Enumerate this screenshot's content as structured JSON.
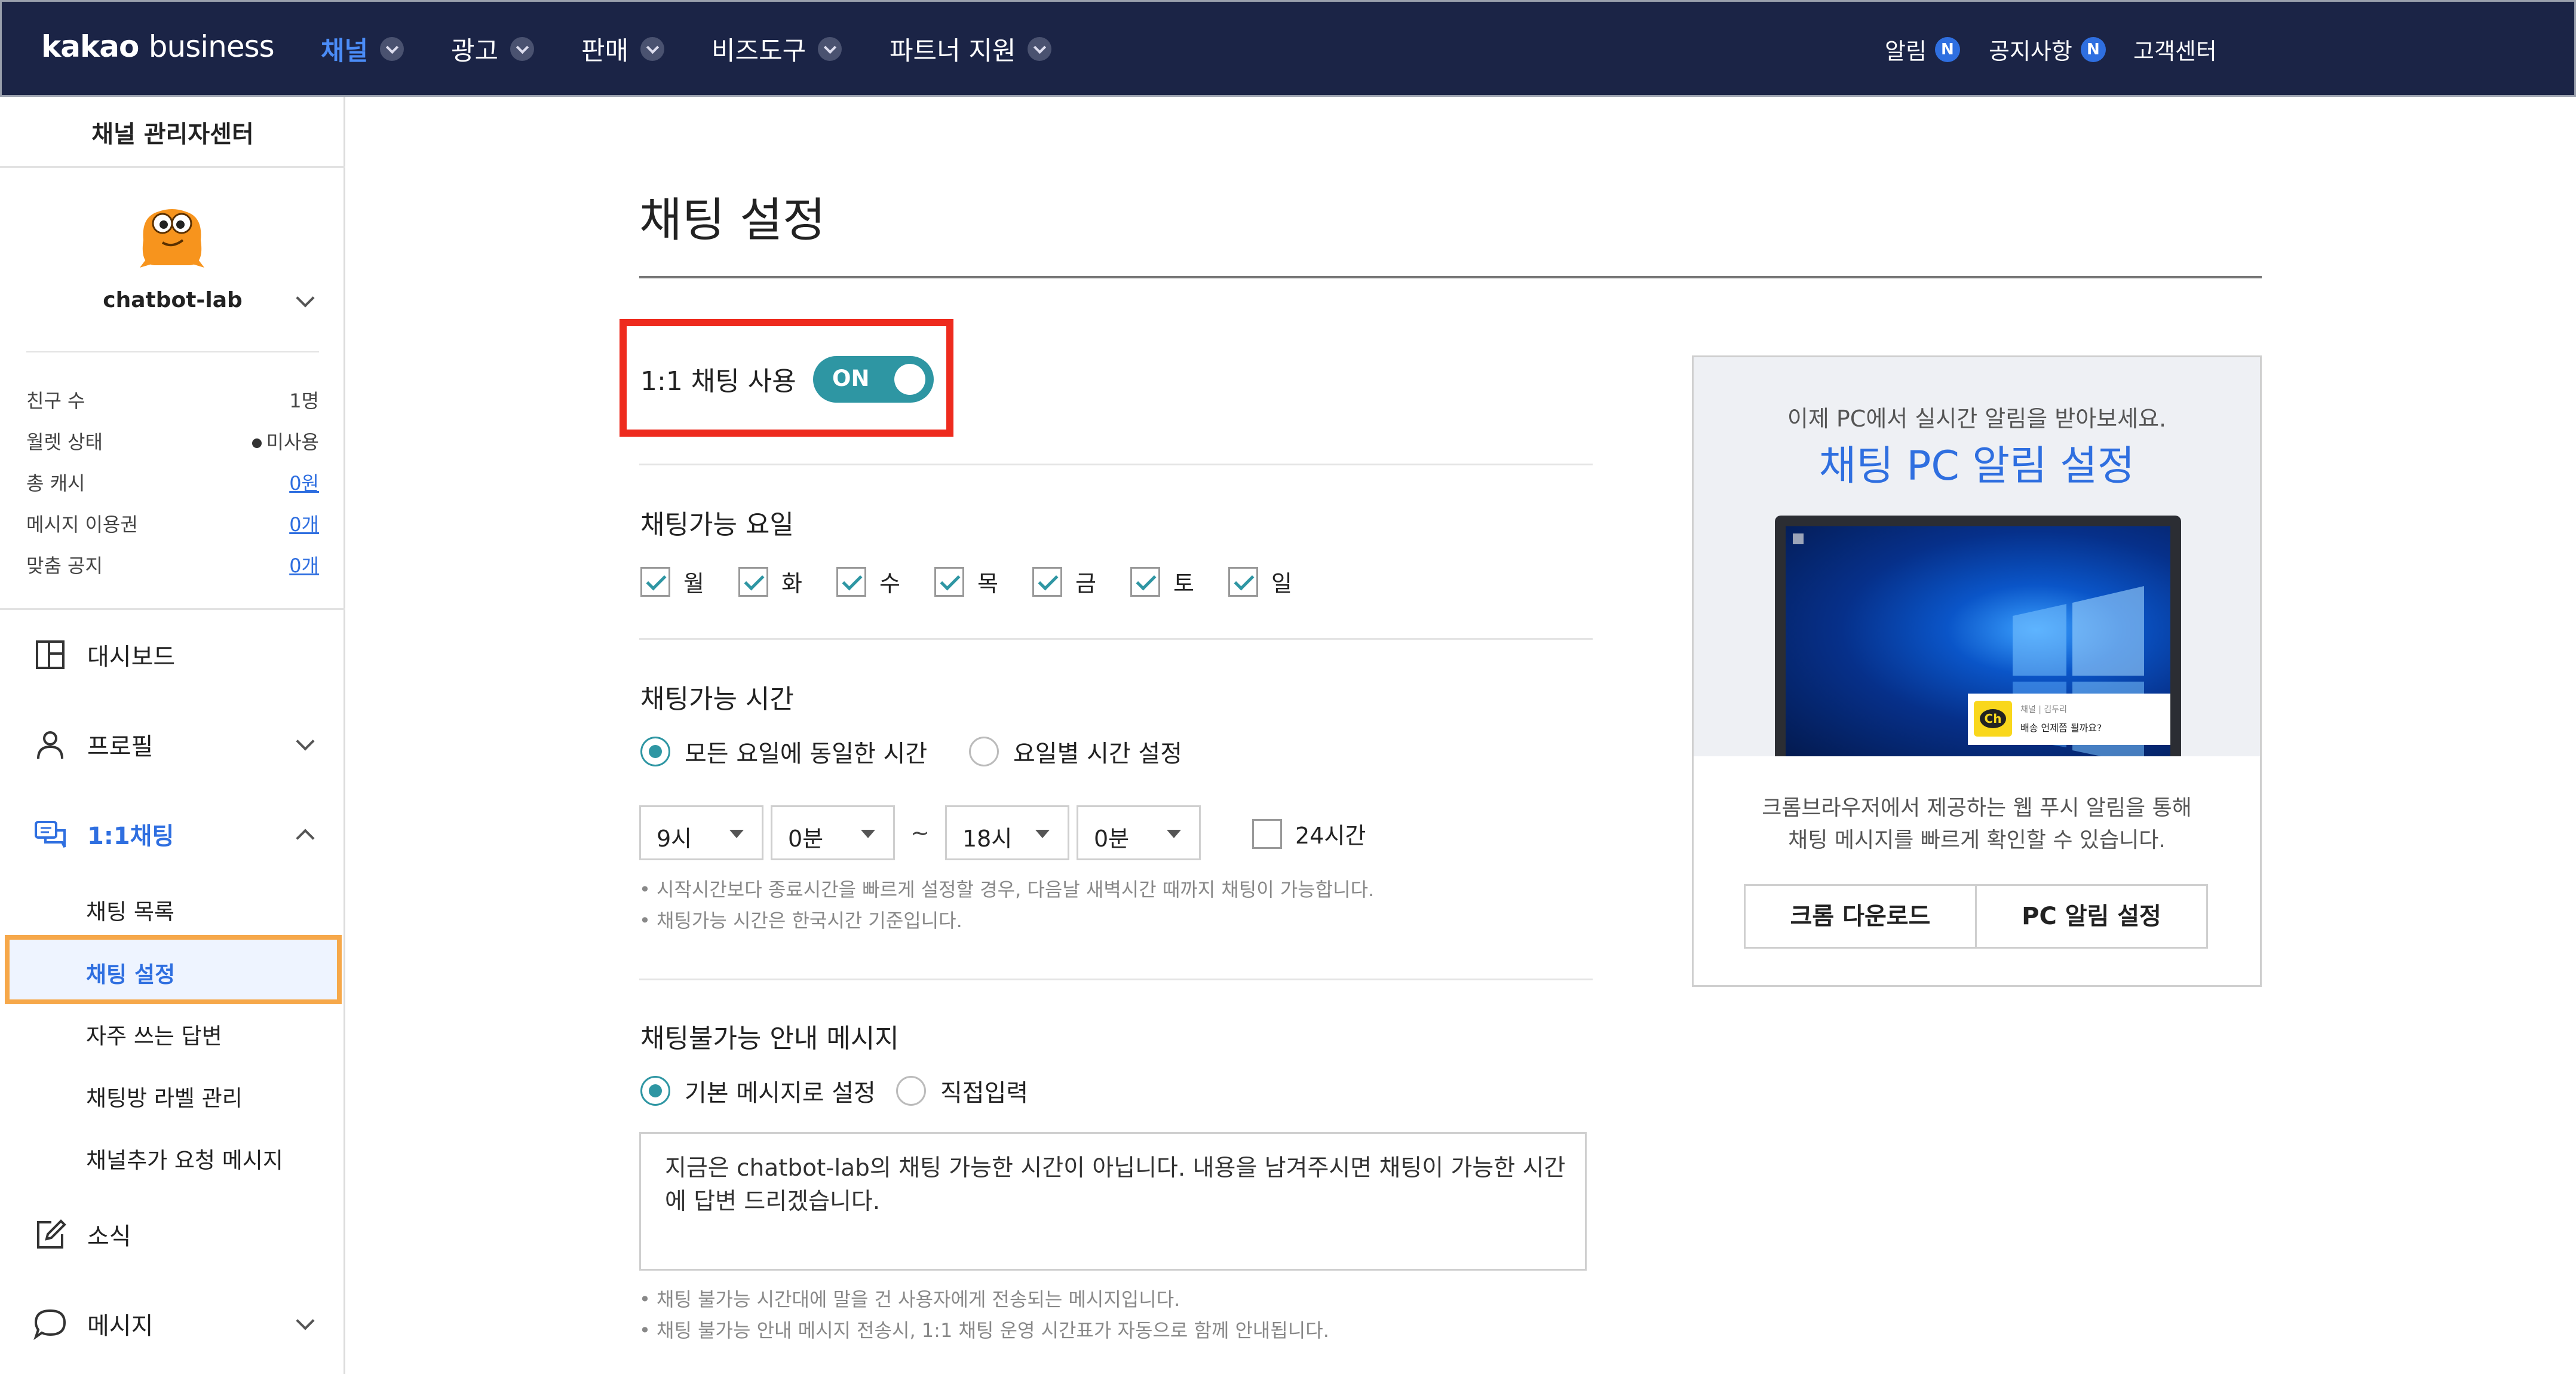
{
  "nav": {
    "logo_bold": "kakao",
    "logo_light": "business",
    "menus": [
      "채널",
      "광고",
      "판매",
      "비즈도구",
      "파트너 지원"
    ],
    "right_links": [
      {
        "label": "알림",
        "badge": "N"
      },
      {
        "label": "공지사항",
        "badge": "N"
      },
      {
        "label": "고객센터"
      }
    ]
  },
  "sidebar": {
    "title": "채널 관리자센터",
    "channel_name": "chatbot-lab",
    "stats": [
      {
        "label": "친구 수",
        "value": "1명"
      },
      {
        "label": "월렛 상태",
        "value": "미사용"
      },
      {
        "label": "총 캐시",
        "value": "0원"
      },
      {
        "label": "메시지 이용권",
        "value": "0개"
      },
      {
        "label": "맞춤 공지",
        "value": "0개"
      }
    ],
    "items": [
      {
        "label": "대시보드"
      },
      {
        "label": "프로필"
      },
      {
        "label": "1:1채팅"
      },
      {
        "label": "소식"
      },
      {
        "label": "메시지"
      }
    ],
    "chat_sub_items": [
      "채팅 목록",
      "채팅 설정",
      "자주 쓰는 답변",
      "채팅방 라벨 관리",
      "채널추가 요청 메시지"
    ]
  },
  "main": {
    "title": "채팅 설정",
    "toggle": {
      "label": "1:1 채팅 사용",
      "state": "ON"
    },
    "days_section": {
      "title": "채팅가능 요일",
      "days": [
        "월",
        "화",
        "수",
        "목",
        "금",
        "토",
        "일"
      ]
    },
    "time_section": {
      "title": "채팅가능 시간",
      "option_all": "모든 요일에 동일한 시간",
      "option_each": "요일별 시간 설정",
      "start_hour": "9시",
      "start_min": "0분",
      "tilde": "~",
      "end_hour": "18시",
      "end_min": "0분",
      "all_day": "24시간",
      "note1": "• 시작시간보다 종료시간을 빠르게 설정할 경우, 다음날 새벽시간 때까지 채팅이 가능합니다.",
      "note2": "• 채팅가능 시간은 한국시간 기준입니다."
    },
    "unavailable_section": {
      "title": "채팅불가능 안내 메시지",
      "option_default": "기본 메시지로 설정",
      "option_custom": "직접입력",
      "message": "지금은 chatbot-lab의 채팅 가능한 시간이 아닙니다. 내용을 남겨주시면 채팅이 가능한 시간에 답변 드리겠습니다.",
      "note1": "• 채팅 불가능 시간대에 말을 건 사용자에게 전송되는 메시지입니다.",
      "note2": "• 채팅 불가능 안내 메시지 전송시, 1:1 채팅 운영 시간표가 자동으로 함께 안내됩니다."
    }
  },
  "promo": {
    "subtitle": "이제 PC에서 실시간 알림을 받아보세요.",
    "title": "채팅 PC 알림 설정",
    "notif_line1": "채널 | 김두리",
    "notif_line2": "배송 언제쯤 될까요?",
    "notif_icon": "Ch",
    "desc_line1": "크롬브라우저에서 제공하는 웹 푸시 알림을 통해",
    "desc_line2": "채팅 메시지를 빠르게 확인할 수 있습니다.",
    "btn_chrome": "크롬 다운로드",
    "btn_pc": "PC 알림 설정"
  },
  "colors": {
    "nav_bg": "#1b2446",
    "accent_blue": "#2f6fe0",
    "toggle_teal": "#2e96a3",
    "highlight_red": "#ee2b1e",
    "highlight_orange": "#f6a84a"
  }
}
